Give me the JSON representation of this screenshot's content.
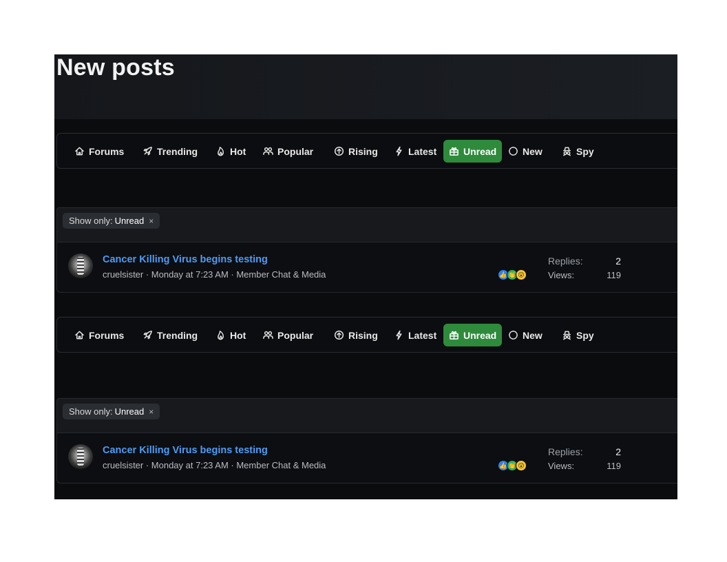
{
  "page": {
    "title": "New posts"
  },
  "tabs": [
    {
      "label": "Forums",
      "icon": "home-icon",
      "active": false
    },
    {
      "label": "Trending",
      "icon": "rocket-icon",
      "active": false
    },
    {
      "label": "Hot",
      "icon": "flame-icon",
      "active": false
    },
    {
      "label": "Popular",
      "icon": "users-icon",
      "active": false
    },
    {
      "label": "Rising",
      "icon": "arrow-up-circle-icon",
      "active": false
    },
    {
      "label": "Latest",
      "icon": "bolt-icon",
      "active": false
    },
    {
      "label": "Unread",
      "icon": "gift-icon",
      "active": true
    },
    {
      "label": "New",
      "icon": "circle-dashed-icon",
      "active": false
    },
    {
      "label": "Spy",
      "icon": "spy-icon",
      "active": false
    }
  ],
  "filter": {
    "prefix": "Show only:",
    "value": "Unread",
    "remove": "×"
  },
  "thread": {
    "title": "Cancer Killing Virus begins testing",
    "meta": "cruelsister · Monday at 7:23 AM · Member Chat & Media",
    "reactions": [
      "like",
      "clap",
      "wow"
    ],
    "replies_label": "Replies:",
    "replies": "2",
    "views_label": "Views:",
    "views": "119"
  },
  "colors": {
    "accent_active": "#2e8b3c",
    "link": "#4f9bf5",
    "background": "#0b0c0e"
  }
}
